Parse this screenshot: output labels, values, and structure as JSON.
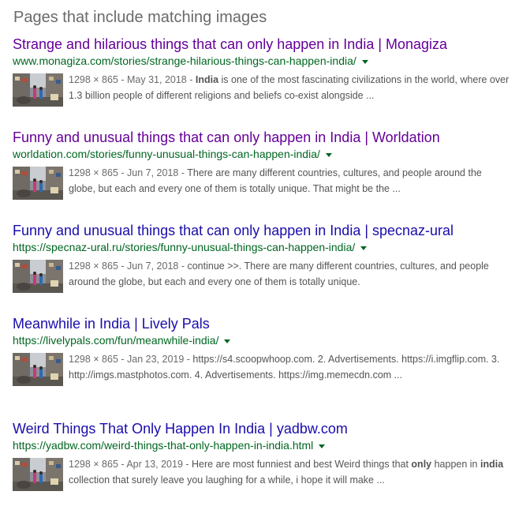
{
  "section_title": "Pages that include matching images",
  "colors": {
    "visited_link": "#660099",
    "unvisited_link": "#1a0dab",
    "url_green": "#006621",
    "snippet_gray": "#545454"
  },
  "icons": {
    "caret": "caret-down-icon",
    "thumbnail": "image-thumbnail"
  },
  "results": [
    {
      "title": "Strange and hilarious things that can only happen in India | Monagiza",
      "visited": true,
      "url": "www.monagiza.com/stories/strange-hilarious-things-can-happen-india/",
      "meta": "1298 × 865 - May 31, 2018 - ",
      "snippet_bold": "India",
      "snippet": " is one of the most fascinating civilizations in the world, where over 1.3 billion people of different religions and beliefs co-exist alongside ..."
    },
    {
      "title": "Funny and unusual things that can only happen in India | Worldation",
      "visited": true,
      "url": "worldation.com/stories/funny-unusual-things-can-happen-india/",
      "meta": "1298 × 865 - Jun 7, 2018 - ",
      "snippet": "There are many different countries, cultures, and people around the globe, but each and every one of them is totally unique. That might be the ..."
    },
    {
      "title": "Funny and unusual things that can only happen in India | specnaz-ural",
      "visited": false,
      "url": "https://specnaz-ural.ru/stories/funny-unusual-things-can-happen-india/",
      "meta": "1298 × 865 - Jun 7, 2018 - ",
      "snippet": "continue >>. There are many different countries, cultures, and people around the globe, but each and every one of them is totally unique."
    },
    {
      "title": "Meanwhile in India | Lively Pals",
      "visited": false,
      "url": "https://livelypals.com/fun/meanwhile-india/",
      "meta": "1298 × 865 - Jan 23, 2019 - ",
      "snippet": "https://s4.scoopwhoop.com. 2. Advertisements. https://i.imgflip.com. 3. http://imgs.mastphotos.com. 4. Advertisements. https://img.memecdn.com ..."
    },
    {
      "title": "Weird Things That Only Happen In India | yadbw.com",
      "visited": false,
      "url": "https://yadbw.com/weird-things-that-only-happen-in-india.html",
      "meta": "1298 × 865 - Apr 13, 2019 - ",
      "snippet_a": "Here are most funniest and best Weird things that ",
      "snippet_bold_a": "only",
      "snippet_b": " happen in ",
      "snippet_bold_b": "india",
      "snippet_c": " collection that surely leave you laughing for a while, i hope it will make ..."
    }
  ]
}
